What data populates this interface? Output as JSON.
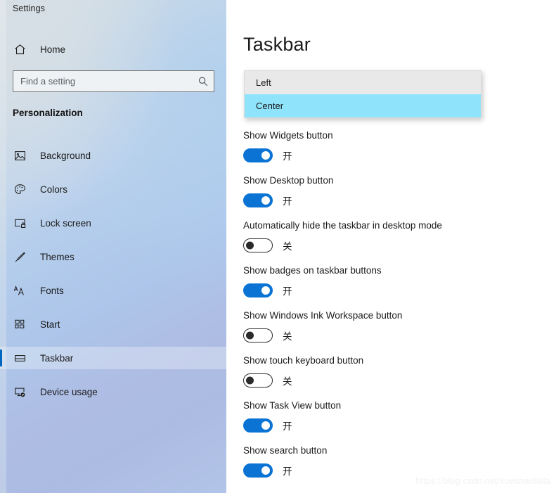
{
  "window": {
    "app_title": "Settings"
  },
  "sidebar": {
    "home": {
      "label": "Home",
      "icon": "home-icon"
    },
    "search": {
      "placeholder": "Find a setting",
      "value": "",
      "icon": "search-icon"
    },
    "section_heading": "Personalization",
    "items": [
      {
        "label": "Background",
        "icon": "picture-icon",
        "selected": false
      },
      {
        "label": "Colors",
        "icon": "palette-icon",
        "selected": false
      },
      {
        "label": "Lock screen",
        "icon": "lock-screen-icon",
        "selected": false
      },
      {
        "label": "Themes",
        "icon": "brush-icon",
        "selected": false
      },
      {
        "label": "Fonts",
        "icon": "fonts-aa-icon",
        "selected": false
      },
      {
        "label": "Start",
        "icon": "start-tiles-icon",
        "selected": false
      },
      {
        "label": "Taskbar",
        "icon": "taskbar-icon",
        "selected": true
      },
      {
        "label": "Device usage",
        "icon": "device-usage-icon",
        "selected": false
      }
    ]
  },
  "main": {
    "page_title": "Taskbar",
    "dropdown": {
      "name": "taskbar-alignment-dropdown",
      "options": [
        {
          "label": "Left",
          "highlighted": false
        },
        {
          "label": "Center",
          "highlighted": true
        }
      ]
    },
    "settings": [
      {
        "label": "Show Widgets button",
        "state": "on",
        "state_label": "开"
      },
      {
        "label": "Show Desktop button",
        "state": "on",
        "state_label": "开"
      },
      {
        "label": "Automatically hide the taskbar in desktop mode",
        "state": "off",
        "state_label": "关"
      },
      {
        "label": "Show badges on taskbar buttons",
        "state": "on",
        "state_label": "开"
      },
      {
        "label": "Show Windows Ink Workspace button",
        "state": "off",
        "state_label": "关"
      },
      {
        "label": "Show touch keyboard button",
        "state": "off",
        "state_label": "关"
      },
      {
        "label": "Show Task View button",
        "state": "on",
        "state_label": "开"
      },
      {
        "label": "Show search button",
        "state": "on",
        "state_label": "开"
      }
    ]
  },
  "watermark": "https://blog.csdn.net/xueshanlaila",
  "colors": {
    "accent_blue": "#0a73d4",
    "selection_bar": "#0067c0",
    "dropdown_bg": "#e9e9e9",
    "dropdown_highlight": "#8fe3fb",
    "toggle_off_border": "#2b2b2b"
  }
}
